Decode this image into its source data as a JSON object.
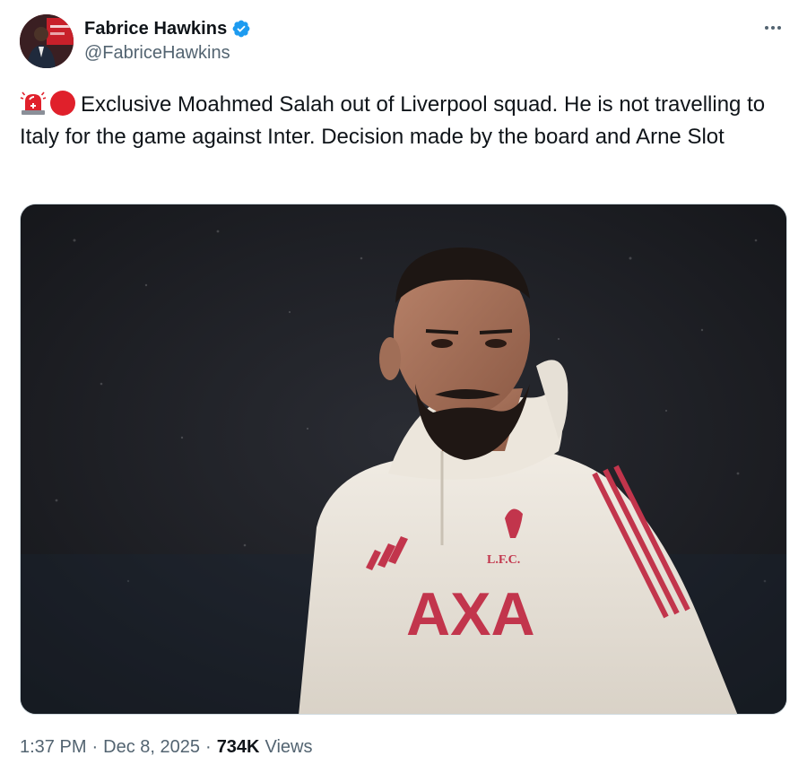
{
  "author": {
    "display_name": "Fabrice Hawkins",
    "handle": "@FabriceHawkins",
    "verified": true,
    "verified_color": "#1d9bf0"
  },
  "more_icon": "more-horizontal-icon",
  "tweet": {
    "emojis": [
      "rotating-light-emoji",
      "red-circle-emoji"
    ],
    "text": "Exclusive Moahmed Salah out of Liverpool squad. He is not travelling to Italy for the game against Inter. Decision made by the board and Arne Slot"
  },
  "media": {
    "type": "photo",
    "jersey_text": "AXA",
    "crest_text": "L.F.C."
  },
  "meta": {
    "time": "1:37 PM",
    "separator": "·",
    "date": "Dec 8, 2025",
    "views_count": "734K",
    "views_label": "Views"
  }
}
